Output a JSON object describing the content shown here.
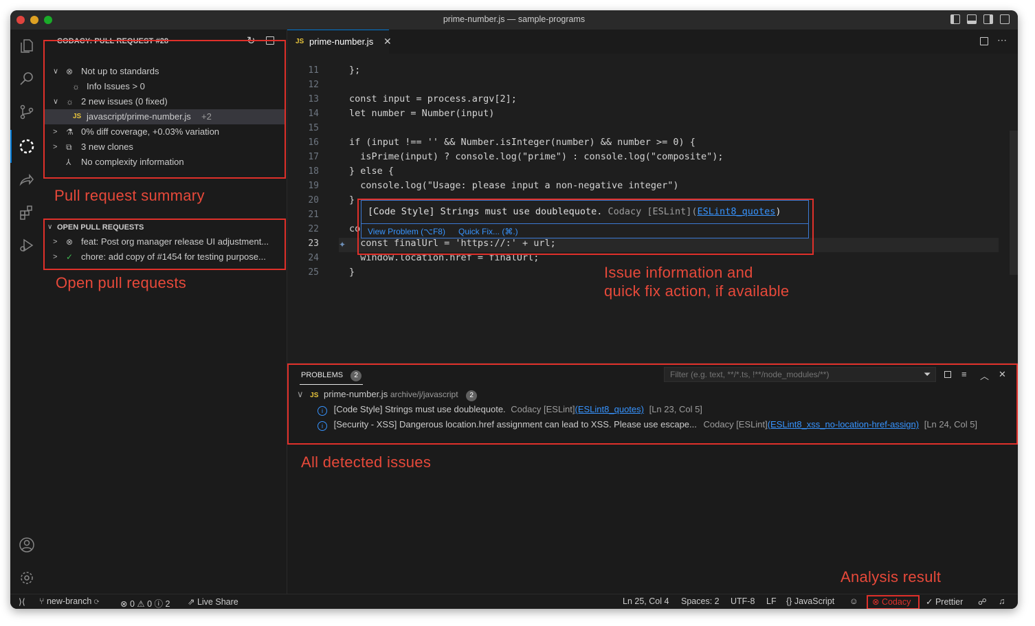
{
  "window": {
    "title": "prime-number.js — sample-programs"
  },
  "sidebar": {
    "section_title": "CODACY: PULL REQUEST #28",
    "summary_items": [
      {
        "label": "Not up to standards"
      },
      {
        "label": "Info Issues > 0"
      },
      {
        "label": "2 new issues (0 fixed)"
      },
      {
        "file": "javascript/prime-number.js",
        "suffix": "+2",
        "badge": "JS"
      },
      {
        "label": "0% diff coverage, +0.03% variation"
      },
      {
        "label": "3 new clones"
      },
      {
        "label": "No complexity information"
      }
    ],
    "open_prs_title": "OPEN PULL REQUESTS",
    "open_prs": [
      {
        "label": "feat: Post org manager release UI adjustment..."
      },
      {
        "label": "chore: add copy of #1454 for testing purpose..."
      }
    ]
  },
  "annotations": {
    "pr_summary": "Pull request summary",
    "open_prs": "Open pull requests",
    "issue_info_1": "Issue information and",
    "issue_info_2": "quick fix action, if available",
    "all_issues": "All detected issues",
    "analysis": "Analysis result"
  },
  "editor": {
    "tab_badge": "JS",
    "tab_name": "prime-number.js",
    "line_numbers": [
      "11",
      "12",
      "13",
      "14",
      "15",
      "16",
      "17",
      "18",
      "19",
      "20",
      "21",
      "22",
      "23",
      "24",
      "25"
    ],
    "current_line": "23",
    "lines": [
      "};",
      "",
      "const input = process.argv[2];",
      "let number = Number(input)",
      "",
      "if (input !== '' && Number.isInteger(number) && number >= 0) {",
      "  isPrime(input) ? console.log(\"prime\") : console.log(\"composite\");",
      "} else {",
      "  console.log(\"Usage: please input a non-negative integer\")",
      "}",
      "",
      "co",
      "  const finalUrl = 'https://:' + url;",
      "  window.location.href = finalUrl;",
      "}"
    ],
    "hover": {
      "message_prefix": "[Code Style] Strings must use doublequote. ",
      "message_source": "Codacy [ESLint](",
      "message_link": "ESLint8_quotes",
      "message_suffix": ")",
      "view_problem": "View Problem (⌥F8)",
      "quick_fix": "Quick Fix... (⌘.)"
    }
  },
  "panel": {
    "tab_label": "PROBLEMS",
    "tab_count": "2",
    "filter_placeholder": "Filter (e.g. text, **/*.ts, !**/node_modules/**)",
    "file": {
      "badge": "JS",
      "name": "prime-number.js",
      "path": "archive/j/javascript",
      "count": "2"
    },
    "problems": [
      {
        "message": "[Code Style] Strings must use doublequote.",
        "source": "Codacy [ESLint]",
        "rule": "(ESLint8_quotes)",
        "location": "[Ln 23, Col 5]"
      },
      {
        "message": "[Security - XSS] Dangerous location.href assignment can lead to XSS. Please use escape...",
        "source": "Codacy [ESLint]",
        "rule": "(ESLint8_xss_no-location-href-assign)",
        "location": "[Ln 24, Col 5]"
      }
    ]
  },
  "statusbar": {
    "branch": "new-branch",
    "errors": "0",
    "warnings": "0",
    "infos": "2",
    "live_share": "Live Share",
    "position": "Ln 25, Col 4",
    "spaces": "Spaces: 2",
    "encoding": "UTF-8",
    "eol": "LF",
    "language": "JavaScript",
    "codacy": "Codacy",
    "prettier": "Prettier"
  },
  "colors": {
    "accent": "#0078d4",
    "annotation": "#e7493a",
    "link": "#3794ff",
    "js": "#e8c43b"
  }
}
